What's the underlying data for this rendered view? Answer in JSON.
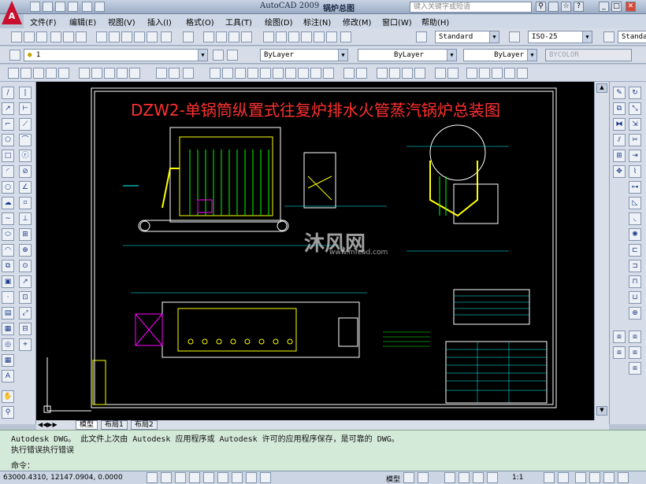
{
  "window": {
    "app_title": "AutoCAD 2009",
    "doc_title": "锅炉总图",
    "search_placeholder": "键入关键字或短语"
  },
  "menu": [
    "文件(F)",
    "编辑(E)",
    "视图(V)",
    "插入(I)",
    "格式(O)",
    "工具(T)",
    "绘图(D)",
    "标注(N)",
    "修改(M)",
    "窗口(W)",
    "帮助(H)"
  ],
  "styles": {
    "text_style": "Standard",
    "dim_style": "ISO-25",
    "table_style": "Standard"
  },
  "layers": {
    "current_layer": "1",
    "color": "ByLayer",
    "linetype": "ByLayer",
    "lineweight": "ByLayer",
    "plotstyle": "BYCOLOR"
  },
  "drawing": {
    "title": "DZW2-单锅筒纵置式往复炉排水火管蒸汽锅炉总装图",
    "watermark": "沐风网",
    "watermark_url": "www.mfcad.com",
    "bg": "#000000",
    "title_color": "#ff3030"
  },
  "layout_tabs": [
    "模型",
    "布局1",
    "布局2"
  ],
  "command_lines": [
    "Autodesk DWG。   此文件上次由 Autodesk 应用程序或 Autodesk 许可的应用程序保存，是可靠的 DWG。",
    "执行错误执行错误",
    "命令："
  ],
  "status": {
    "coords": "63000.4310, 12147.0904, 0.0000",
    "model": "模型",
    "scale": "1:1"
  }
}
